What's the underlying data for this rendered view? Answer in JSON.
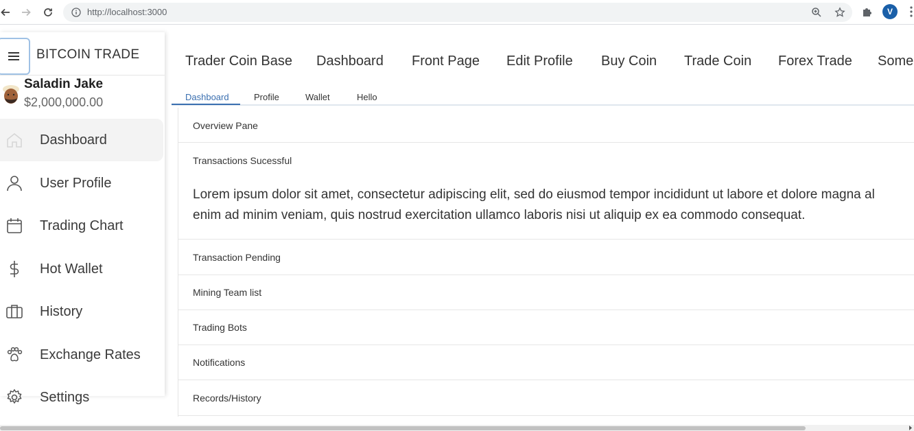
{
  "browser": {
    "url": "http://localhost:3000",
    "profile_initial": "V"
  },
  "sidebar": {
    "brand": "BITCOIN TRADE",
    "user": {
      "name": "Saladin Jake",
      "balance": "$2,000,000.00"
    },
    "items": [
      {
        "label": "Dashboard",
        "icon": "home-icon",
        "active": true
      },
      {
        "label": "User Profile",
        "icon": "user-icon",
        "active": false
      },
      {
        "label": "Trading Chart",
        "icon": "calendar-icon",
        "active": false
      },
      {
        "label": "Hot Wallet",
        "icon": "dollar-icon",
        "active": false
      },
      {
        "label": "History",
        "icon": "briefcase-icon",
        "active": false
      },
      {
        "label": "Exchange Rates",
        "icon": "paw-icon",
        "active": false
      },
      {
        "label": "Settings",
        "icon": "gear-icon",
        "active": false
      }
    ]
  },
  "topnav": [
    "Trader Coin Base",
    "Dashboard",
    "Front Page",
    "Edit Profile",
    "Buy Coin",
    "Trade Coin",
    "Forex Trade",
    "Some"
  ],
  "tabs": [
    {
      "label": "Dashboard",
      "active": true
    },
    {
      "label": "Profile",
      "active": false
    },
    {
      "label": "Wallet",
      "active": false
    },
    {
      "label": "Hello",
      "active": false
    }
  ],
  "accordion": {
    "items": [
      "Overview Pane",
      "Transactions Sucessful",
      "Transaction Pending",
      "Mining Team list",
      "Trading Bots",
      "Notifications",
      "Records/History"
    ],
    "expanded_text_line1": "Lorem ipsum dolor sit amet, consectetur adipiscing elit, sed do eiusmod tempor incididunt ut labore et dolore magna al",
    "expanded_text_line2": "enim ad minim veniam, quis nostrud exercitation ullamco laboris nisi ut aliquip ex ea commodo consequat."
  },
  "colors": {
    "accent": "#3a6fb0",
    "profile_badge": "#1a5fa8"
  }
}
